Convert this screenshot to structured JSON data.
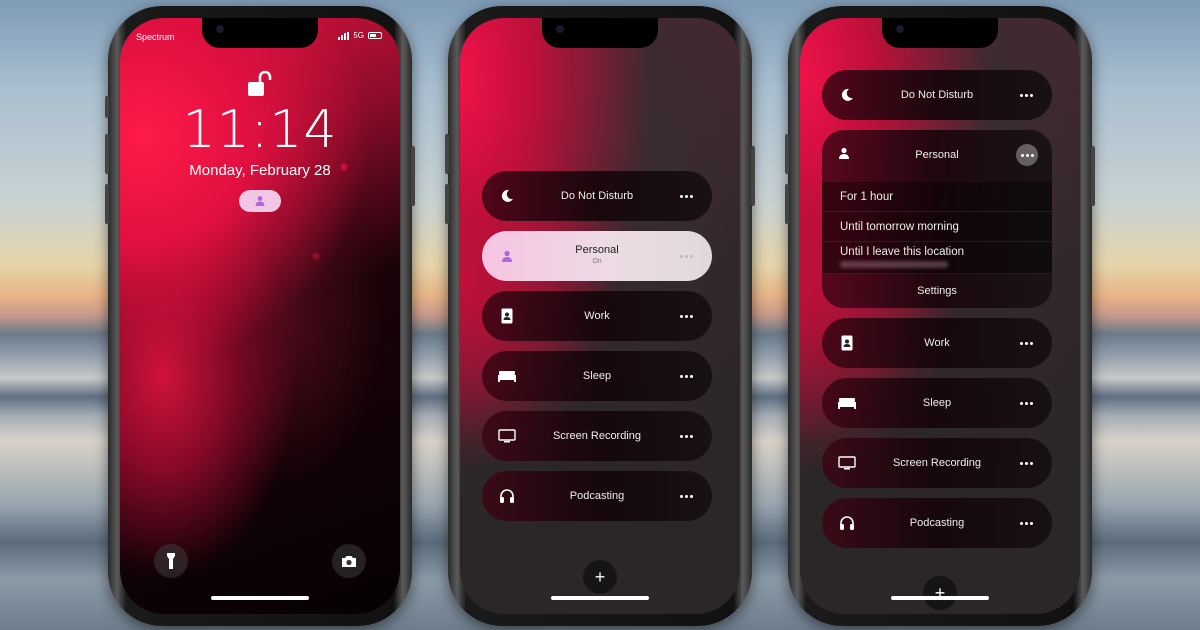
{
  "lock_screen": {
    "carrier": "Spectrum",
    "network": "5G",
    "time": "11:14",
    "date": "Monday, February 28",
    "focus_indicator_icon": "person-icon",
    "left_button_icon": "flashlight-icon",
    "right_button_icon": "camera-icon"
  },
  "focus_picker": {
    "modes": [
      {
        "label": "Do Not Disturb",
        "icon": "moon-icon",
        "active": false
      },
      {
        "label": "Personal",
        "sublabel": "On",
        "icon": "person-icon",
        "active": true
      },
      {
        "label": "Work",
        "icon": "id-badge-icon",
        "active": false
      },
      {
        "label": "Sleep",
        "icon": "bed-icon",
        "active": false
      },
      {
        "label": "Screen Recording",
        "icon": "monitor-icon",
        "active": false
      },
      {
        "label": "Podcasting",
        "icon": "headphones-icon",
        "active": false
      }
    ],
    "add_button": "+"
  },
  "focus_expanded": {
    "modes": [
      {
        "label": "Do Not Disturb",
        "icon": "moon-icon"
      },
      {
        "label": "Personal",
        "icon": "person-icon",
        "expanded": true
      },
      {
        "label": "Work",
        "icon": "id-badge-icon"
      },
      {
        "label": "Sleep",
        "icon": "bed-icon"
      },
      {
        "label": "Screen Recording",
        "icon": "monitor-icon"
      },
      {
        "label": "Podcasting",
        "icon": "headphones-icon"
      }
    ],
    "duration_options": [
      "For 1 hour",
      "Until tomorrow morning",
      "Until I leave this location"
    ],
    "settings_label": "Settings"
  },
  "colors": {
    "accent_red": "#e0123e",
    "active_pill": "#f2c6e6",
    "person_icon": "#b065d8"
  }
}
